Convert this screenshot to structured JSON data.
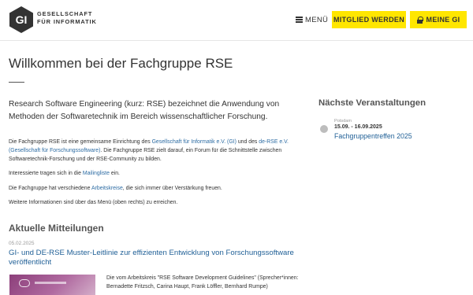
{
  "header": {
    "logo_line1": "GESELLSCHAFT",
    "logo_line2": "FÜR INFORMATIK",
    "menu_label": "MENÜ",
    "member_label": "MITGLIED WERDEN",
    "meine_label": "MEINE GI"
  },
  "main": {
    "title": "Willkommen bei der Fachgruppe RSE",
    "lead": "Research Software Engineering (kurz: RSE) bezeichnet die Anwendung von Methoden der Softwaretechnik im Bereich wissenschaftlicher Forschung.",
    "p1_a": "Die Fachgruppe RSE ist eine gemeinsame Einrichtung des ",
    "p1_link1": "Gesellschaft für Informatik e.V. (GI)",
    "p1_b": " und des ",
    "p1_link2": "de-RSE e.V. (Gesellschaft für Forschungssoftware)",
    "p1_c": ". Die Fachgruppe RSE zielt darauf, ein Forum für die Schnittstelle zwischen Softwaretechnik-Forschung und der RSE-Community zu bilden.",
    "p2_a": "Interessierte tragen sich in die ",
    "p2_link": "Mailingliste",
    "p2_b": " ein.",
    "p3_a": "Die Fachgruppe hat verschiedene ",
    "p3_link": "Arbeitskreise",
    "p3_b": ", die sich immer über Verstärkung freuen.",
    "p4": "Weitere Informationen sind über das Menü (oben rechts) zu erreichen."
  },
  "news": {
    "section_title": "Aktuelle Mitteilungen",
    "date": "05.02.2025",
    "title": "GI- und DE-RSE Muster-Leitlinie zur effizienten Entwicklung von Forschungssoft­ware veröffentlicht",
    "excerpt": "Die vom Arbeitskreis \"RSE Software Development Guidelines\" (Sprecher*innen: Bernadette Fritzsch, Carina Haupt, Frank Löffler, Bernhard Rumpe)"
  },
  "sidebar": {
    "title": "Nächste Veranstaltungen",
    "event_location": "Potsdam",
    "event_dates": "15.09. - 16.09.2025",
    "event_name": "Fachgruppentreffen 2025"
  },
  "colors": {
    "accent_yellow": "#ffe600",
    "link_blue": "#2d6ca3"
  }
}
